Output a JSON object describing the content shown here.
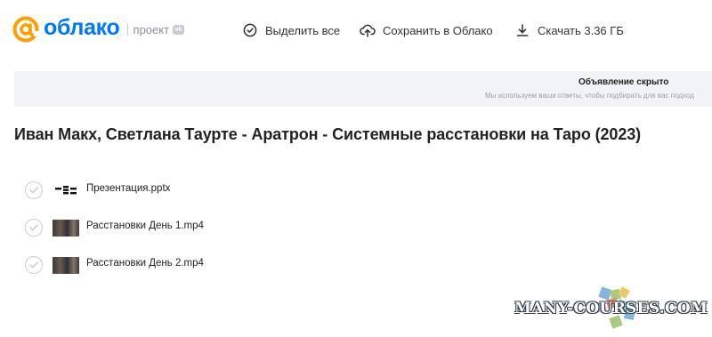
{
  "header": {
    "logo_text": "облако",
    "project_label": "проект",
    "vk_badge": "vk",
    "toolbar": {
      "select_all": "Выделить все",
      "save_to_cloud": "Сохранить в Облако",
      "download": "Скачать 3.36 ГБ"
    }
  },
  "ad": {
    "title": "Объявление скрыто",
    "subtitle": "Мы используем ваши ответы, чтобы подбирать для вас подход"
  },
  "page_title": "Иван Макх, Светлана Таурте - Аратрон - Системные расстановки на Таро (2023)",
  "files": [
    {
      "name": "Презентация.pptx",
      "icon": "presentation-file-icon"
    },
    {
      "name": "Расстановки День 1.mp4",
      "icon": "video-thumbnail"
    },
    {
      "name": "Расстановки День 2.mp4",
      "icon": "video-thumbnail"
    }
  ],
  "watermark": "MANY-COURSES.COM",
  "colors": {
    "brand_blue": "#0077ff",
    "brand_orange": "#ff9e00",
    "ad_background": "#f1f3f7"
  }
}
